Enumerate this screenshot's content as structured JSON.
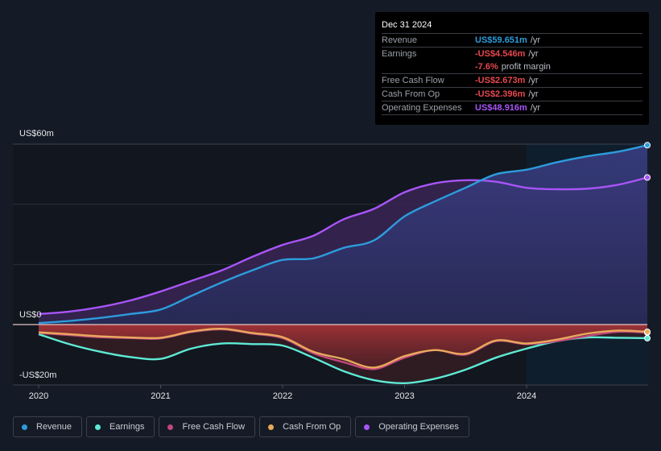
{
  "tooltip": {
    "date": "Dec 31 2024",
    "rows": [
      {
        "label": "Revenue",
        "value": "US$59.651m",
        "unit": "/yr",
        "color": "#2d9cdb"
      },
      {
        "label": "Earnings",
        "value": "-US$4.546m",
        "unit": "/yr",
        "color": "#e5484d"
      },
      {
        "label": "",
        "value": "-7.6%",
        "unit": "profit margin",
        "color": "#e5484d"
      },
      {
        "label": "Free Cash Flow",
        "value": "-US$2.673m",
        "unit": "/yr",
        "color": "#e5484d"
      },
      {
        "label": "Cash From Op",
        "value": "-US$2.396m",
        "unit": "/yr",
        "color": "#e5484d"
      },
      {
        "label": "Operating Expenses",
        "value": "US$48.916m",
        "unit": "/yr",
        "color": "#a855f7"
      }
    ]
  },
  "axis": {
    "y_top_label": "US$60m",
    "y_zero_label": "US$0",
    "y_bottom_label": "-US$20m",
    "x_labels": [
      "2020",
      "2021",
      "2022",
      "2023",
      "2024"
    ]
  },
  "legend": [
    {
      "label": "Revenue",
      "color": "#2d9cdb"
    },
    {
      "label": "Earnings",
      "color": "#5eead4"
    },
    {
      "label": "Free Cash Flow",
      "color": "#c2477d"
    },
    {
      "label": "Cash From Op",
      "color": "#e8a95b"
    },
    {
      "label": "Operating Expenses",
      "color": "#a855f7"
    }
  ],
  "chart_data": {
    "type": "area",
    "title": "",
    "xlabel": "",
    "ylabel": "",
    "ylim": [
      -20,
      60
    ],
    "xlim": [
      2019.8,
      2025.0
    ],
    "x_ticks": [
      2020,
      2021,
      2022,
      2023,
      2024
    ],
    "y_ticks": [
      -20,
      0,
      60
    ],
    "grid": true,
    "forecast_shade_from": 2024.0,
    "x": [
      2020.0,
      2020.25,
      2020.5,
      2020.75,
      2021.0,
      2021.25,
      2021.5,
      2021.75,
      2022.0,
      2022.25,
      2022.5,
      2022.75,
      2023.0,
      2023.25,
      2023.5,
      2023.75,
      2024.0,
      2024.25,
      2024.5,
      2024.75,
      2025.0
    ],
    "series": [
      {
        "name": "Revenue",
        "color": "#2d9cdb",
        "values": [
          0.5,
          1.2,
          2.2,
          3.5,
          5.0,
          9.5,
          14.0,
          18.0,
          21.5,
          22.0,
          25.5,
          28.0,
          36.0,
          41.0,
          45.5,
          50.0,
          51.5,
          54.0,
          56.0,
          57.5,
          59.651
        ]
      },
      {
        "name": "Earnings",
        "color": "#5eead4",
        "values": [
          -3.2,
          -6.5,
          -9.0,
          -10.8,
          -11.4,
          -8.0,
          -6.3,
          -6.5,
          -7.0,
          -11.0,
          -15.5,
          -18.5,
          -19.5,
          -18.0,
          -15.0,
          -11.0,
          -8.0,
          -5.5,
          -4.3,
          -4.4,
          -4.546
        ]
      },
      {
        "name": "Free Cash Flow",
        "color": "#c2477d",
        "values": [
          -2.8,
          -3.5,
          -4.2,
          -4.5,
          -4.6,
          -2.5,
          -1.6,
          -3.0,
          -4.5,
          -9.5,
          -12.5,
          -14.8,
          -11.0,
          -8.5,
          -10.0,
          -5.5,
          -6.5,
          -5.5,
          -3.8,
          -2.4,
          -2.673
        ]
      },
      {
        "name": "Cash From Op",
        "color": "#e8a95b",
        "values": [
          -2.6,
          -3.2,
          -3.9,
          -4.3,
          -4.4,
          -2.3,
          -1.4,
          -2.8,
          -4.2,
          -9.0,
          -11.5,
          -14.3,
          -10.5,
          -8.5,
          -9.7,
          -5.3,
          -6.3,
          -5.0,
          -3.0,
          -2.0,
          -2.396
        ]
      },
      {
        "name": "Operating Expenses",
        "color": "#a855f7",
        "values": [
          3.5,
          4.3,
          5.8,
          8.0,
          11.0,
          14.5,
          18.0,
          22.5,
          26.5,
          29.5,
          35.0,
          38.5,
          44.0,
          47.0,
          48.0,
          47.5,
          45.5,
          45.0,
          45.2,
          46.5,
          48.916
        ]
      }
    ]
  }
}
